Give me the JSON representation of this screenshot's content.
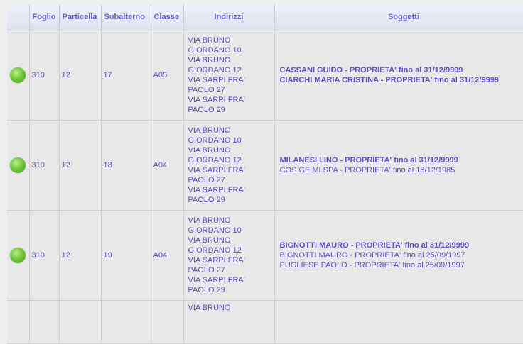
{
  "headers": {
    "status": "",
    "foglio": "Foglio",
    "particella": "Particella",
    "subalterno": "Subalterno",
    "classe": "Classe",
    "indirizzi": "Indirizzi",
    "soggetti": "Soggetti"
  },
  "rows": [
    {
      "foglio": "310",
      "particella": "12",
      "subalterno": "17",
      "classe": "A05",
      "indirizzi": [
        "VIA BRUNO",
        "GIORDANO 10",
        "VIA BRUNO",
        "GIORDANO 12",
        "VIA SARPI FRA'",
        "PAOLO 27",
        "VIA SARPI FRA'",
        "PAOLO 29"
      ],
      "soggetti": [
        {
          "text": "CASSANI GUIDO - PROPRIETA' fino al 31/12/9999",
          "active": true
        },
        {
          "text": "CIARCHI MARIA CRISTINA - PROPRIETA' fino al 31/12/9999",
          "active": true
        }
      ]
    },
    {
      "foglio": "310",
      "particella": "12",
      "subalterno": "18",
      "classe": "A04",
      "indirizzi": [
        "VIA BRUNO",
        "GIORDANO 10",
        "VIA BRUNO",
        "GIORDANO 12",
        "VIA SARPI FRA'",
        "PAOLO 27",
        "VIA SARPI FRA'",
        "PAOLO 29"
      ],
      "soggetti": [
        {
          "text": "MILANESI LINO - PROPRIETA' fino al 31/12/9999",
          "active": true
        },
        {
          "text": "COS GE MI SPA - PROPRIETA' fino al 18/12/1985",
          "active": false
        }
      ]
    },
    {
      "foglio": "310",
      "particella": "12",
      "subalterno": "19",
      "classe": "A04",
      "indirizzi": [
        "VIA BRUNO",
        "GIORDANO 10",
        "VIA BRUNO",
        "GIORDANO 12",
        "VIA SARPI FRA'",
        "PAOLO 27",
        "VIA SARPI FRA'",
        "PAOLO 29"
      ],
      "soggetti": [
        {
          "text": "BIGNOTTI MAURO - PROPRIETA' fino al 31/12/9999",
          "active": true
        },
        {
          "text": "BIGNOTTI MAURO - PROPRIETA' fino al 25/09/1997",
          "active": false
        },
        {
          "text": "PUGLIESE PAOLO - PROPRIETA' fino al 25/09/1997",
          "active": false
        }
      ]
    }
  ],
  "partial_row": {
    "indirizzi_first": "VIA BRUNO"
  }
}
